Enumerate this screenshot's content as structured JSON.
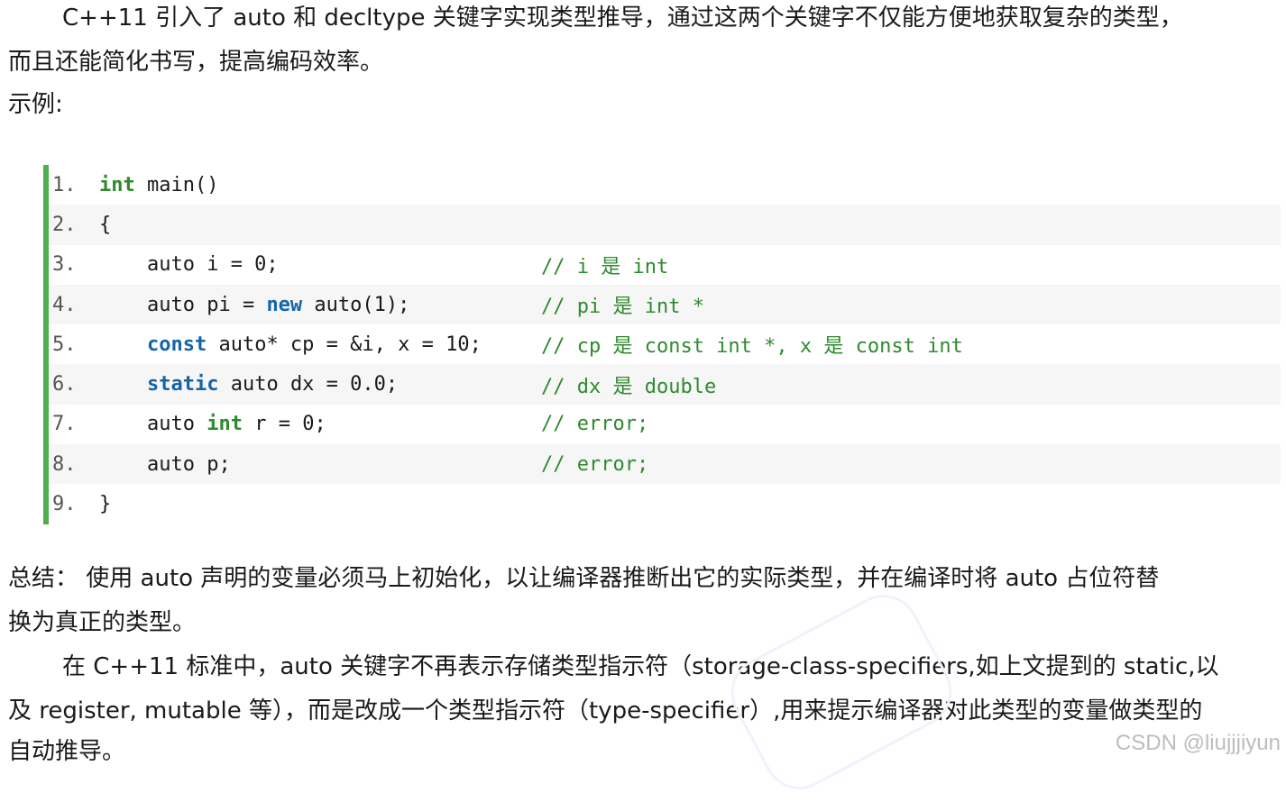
{
  "intro": {
    "line1": "C++11 引入了 auto 和 decltype 关键字实现类型推导，通过这两个关键字不仅能方便地获取复杂的类型，",
    "line2": "而且还能简化书写，提高编码效率。"
  },
  "example_label": "示例:",
  "code": {
    "lines": [
      {
        "num": "1.",
        "pre": "",
        "kw": "int",
        "post": " main()",
        "comment": ""
      },
      {
        "num": "2.",
        "pre": "{",
        "kw": "",
        "post": "",
        "comment": ""
      },
      {
        "num": "3.",
        "pre": "    auto i = 0;",
        "kw": "",
        "post": "",
        "comment": "// i 是 int"
      },
      {
        "num": "4.",
        "pre": "    auto pi = ",
        "kw": "new",
        "post": " auto(1);",
        "comment": "// pi 是 int *"
      },
      {
        "num": "5.",
        "pre": "    ",
        "kw": "const",
        "post": " auto* cp = &i, x = 10;",
        "comment": "// cp 是 const int *, x 是 const int"
      },
      {
        "num": "6.",
        "pre": "    ",
        "kw": "static",
        "post": " auto dx = 0.0;",
        "comment": "// dx 是 double"
      },
      {
        "num": "7.",
        "pre": "    auto ",
        "kw": "int",
        "post": " r = 0;",
        "comment": "// error;"
      },
      {
        "num": "8.",
        "pre": "    auto p;",
        "kw": "",
        "post": "",
        "comment": "// error;"
      },
      {
        "num": "9.",
        "pre": "}",
        "kw": "",
        "post": "",
        "comment": ""
      }
    ]
  },
  "summary": {
    "line1": "总结：  使用 auto 声明的变量必须马上初始化，以让编译器推断出它的实际类型，并在编译时将 auto 占位符替",
    "line2": "换为真正的类型。"
  },
  "detail": {
    "line1": "在 C++11 标准中，auto 关键字不再表示存储类型指示符（storage-class-specifiers,如上文提到的 static,以",
    "line2": "及 register, mutable 等），而是改成一个类型指示符（type-specifier）,用来提示编译器对此类型的变量做类型的",
    "line3": "自动推导。"
  },
  "watermark": "CSDN @liujjjiyun"
}
